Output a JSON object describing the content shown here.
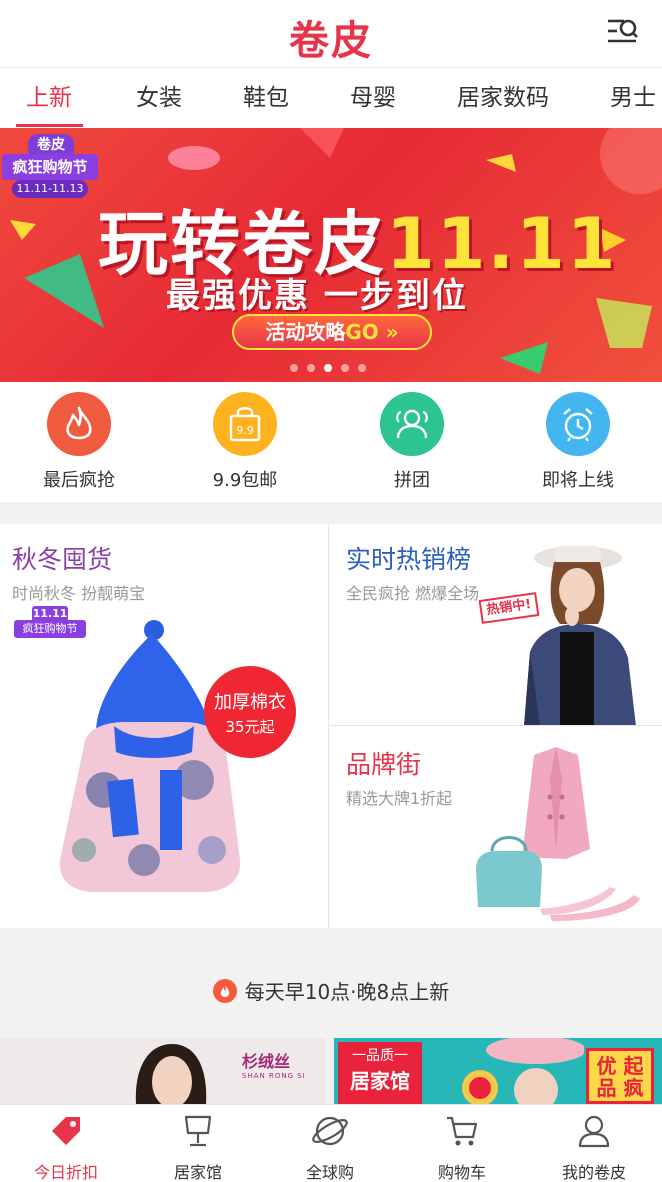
{
  "header": {
    "logo": "卷皮",
    "menu_search_icon": "menu-search-icon"
  },
  "tabs": [
    {
      "label": "上新",
      "active": true
    },
    {
      "label": "女装"
    },
    {
      "label": "鞋包"
    },
    {
      "label": "母婴"
    },
    {
      "label": "居家数码"
    },
    {
      "label": "男士"
    }
  ],
  "banner": {
    "badge_top": "卷皮",
    "badge_mid": "疯狂购物节",
    "badge_date": "11.11-11.13",
    "title_text": "玩转卷皮",
    "title_num": "11.11",
    "subtitle": "最强优惠  一步到位",
    "button_text": "活动攻略",
    "button_go": "GO »",
    "slides": 5,
    "active_slide": 3
  },
  "quick_entries": [
    {
      "label": "最后疯抢",
      "icon": "flame-icon",
      "color": "#f05a3f"
    },
    {
      "label": "9.9包邮",
      "icon": "bag-9-9-icon",
      "icon_text": "9.9",
      "color": "#ffb21f"
    },
    {
      "label": "拼团",
      "icon": "group-icon",
      "color": "#2cc48f"
    },
    {
      "label": "即将上线",
      "icon": "alarm-clock-icon",
      "color": "#43b6f0"
    }
  ],
  "promos": {
    "left": {
      "title": "秋冬囤货",
      "subtitle": "时尚秋冬 扮靓萌宝",
      "title_color": "#8b3fa8",
      "badge_top": "11.11",
      "badge_bottom": "疯狂购物节",
      "price_tag_line1": "加厚棉衣",
      "price_tag_line2": "35元起"
    },
    "right_top": {
      "title": "实时热销榜",
      "subtitle": "全民疯抢 燃爆全场",
      "title_color": "#2b5fc2",
      "tag": "热销中!"
    },
    "right_bottom": {
      "title": "品牌街",
      "subtitle": "精选大牌1折起",
      "title_color": "#e8344a"
    }
  },
  "notice": {
    "text": "每天早10点·晚8点上新"
  },
  "previews": {
    "left_brand": "杉绒丝",
    "left_brand_en": "SHAN RONG SI",
    "right_q1": "一品质一",
    "right_q2": "居家馆",
    "right_badge1": "优 起",
    "right_badge2": "品 疯"
  },
  "bottom_nav": [
    {
      "label": "今日折扣",
      "icon": "tag-icon",
      "active": true
    },
    {
      "label": "居家馆",
      "icon": "lamp-icon"
    },
    {
      "label": "全球购",
      "icon": "planet-icon"
    },
    {
      "label": "购物车",
      "icon": "cart-icon"
    },
    {
      "label": "我的卷皮",
      "icon": "user-icon"
    }
  ],
  "colors": {
    "accent": "#e8344a"
  }
}
